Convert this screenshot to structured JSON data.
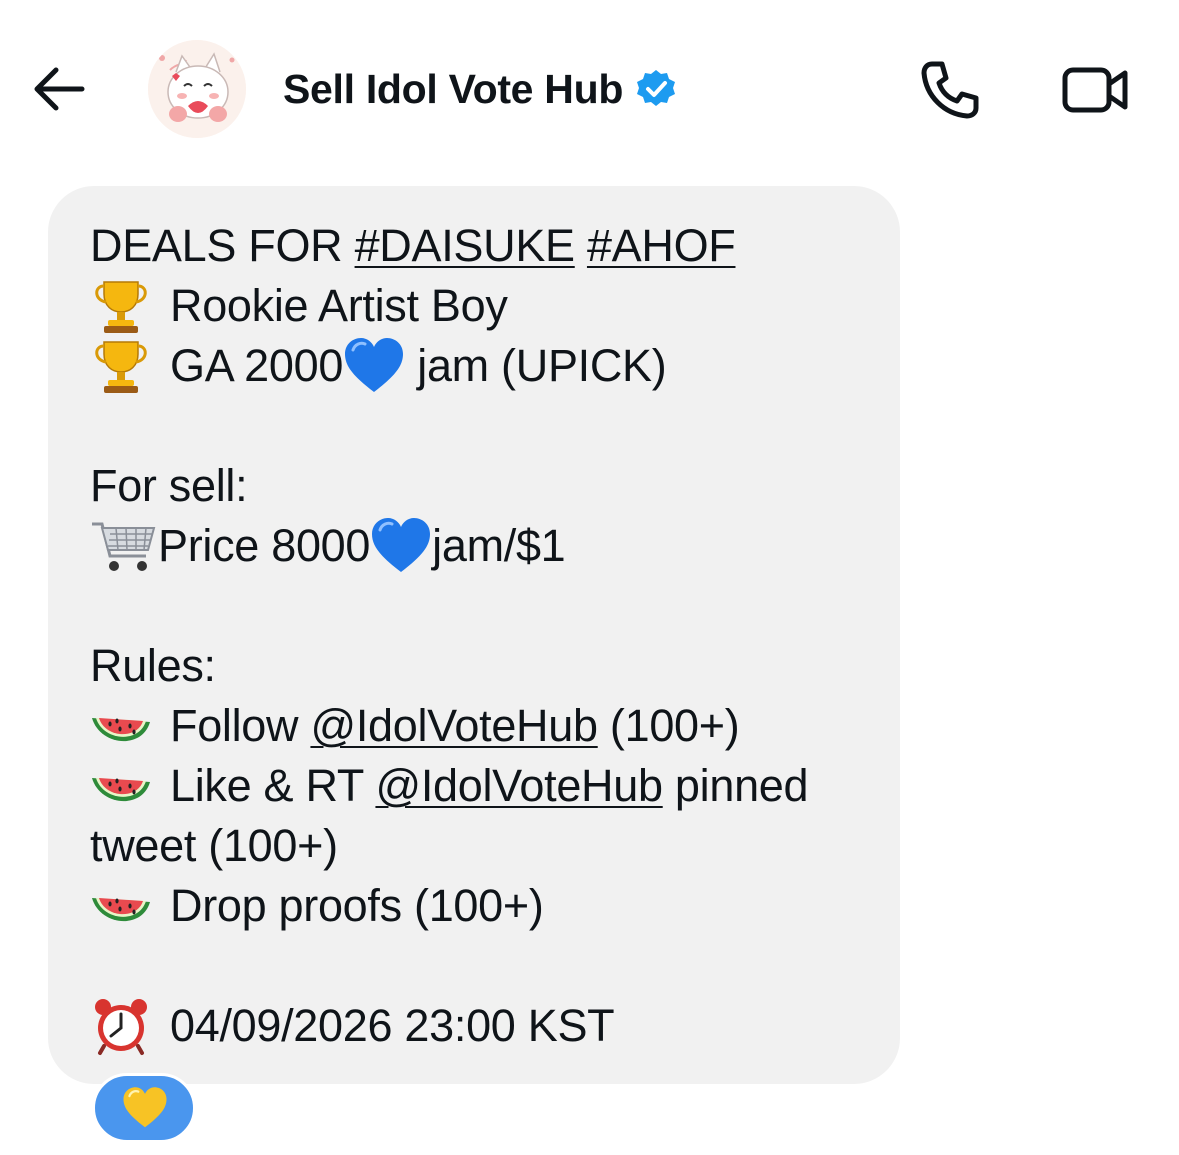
{
  "header": {
    "title": "Sell Idol Vote Hub",
    "verified": true,
    "icons": {
      "back": "arrow-left-icon",
      "call": "phone-icon",
      "video": "video-camera-icon",
      "verified": "verified-badge-icon"
    }
  },
  "message": {
    "line1": {
      "text": "DEALS FOR ",
      "tag1": "#DAISUKE",
      "space": " ",
      "tag2": "#AHOF"
    },
    "line2": {
      "emoji": "trophy",
      "text": "Rookie Artist Boy"
    },
    "line3": {
      "emoji": "trophy",
      "text_before": "GA 2000",
      "heart": "blue-heart",
      "text_after": " jam (UPICK)"
    },
    "line5": {
      "text": "For sell:"
    },
    "line6": {
      "emoji": "shopping-cart",
      "text_before": "Price 8000",
      "heart": "blue-heart",
      "text_after": "jam/$1"
    },
    "line8": {
      "text": "Rules:"
    },
    "line9": {
      "emoji": "watermelon",
      "text_before": "Follow ",
      "mention": "@IdolVoteHub",
      "text_after": " (100+)"
    },
    "line10": {
      "emoji": "watermelon",
      "text_before": "Like & RT ",
      "mention": "@IdolVoteHub",
      "text_after": " pinned"
    },
    "line11": {
      "text": "tweet (100+)"
    },
    "line12": {
      "emoji": "watermelon",
      "text": "Drop proofs (100+)"
    },
    "line14": {
      "emoji": "alarm-clock",
      "text": "04/09/2026 23:00 KST"
    }
  },
  "reaction": {
    "emoji": "yellow-heart",
    "color": "#4a96ee"
  },
  "colors": {
    "bubble": "#f1f1f1",
    "verified": "#1d9bf0",
    "text": "#0f1419"
  }
}
